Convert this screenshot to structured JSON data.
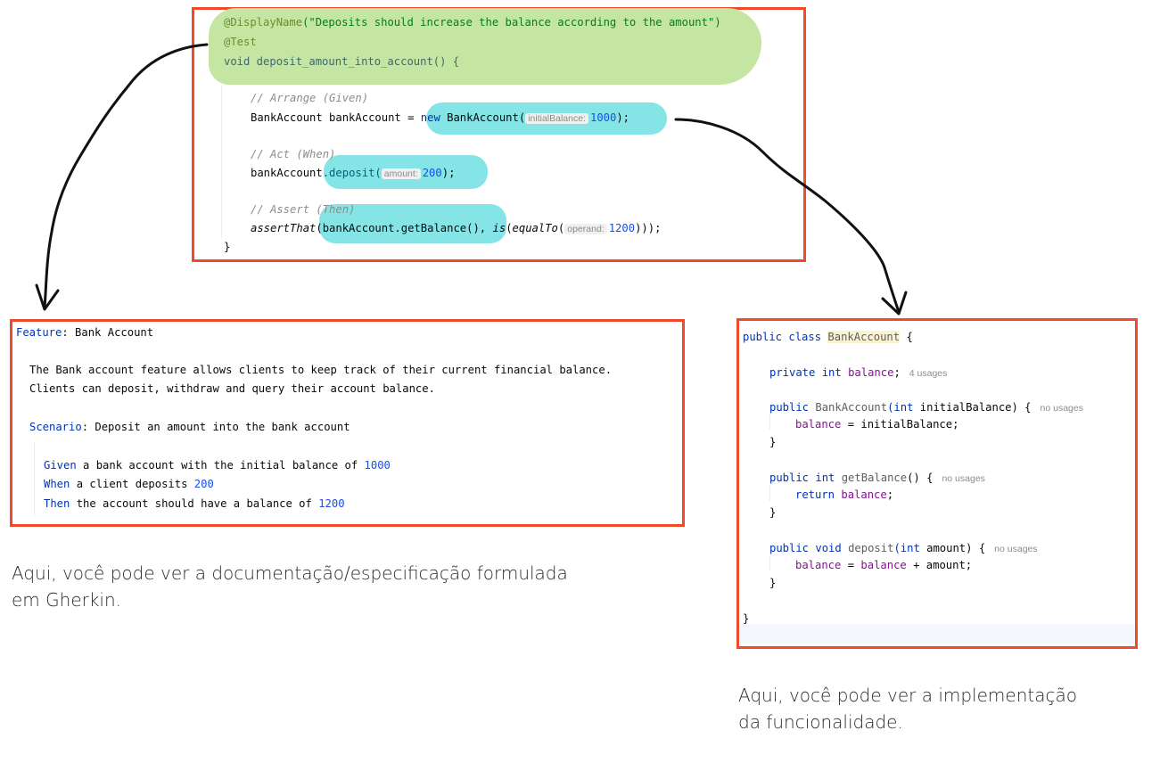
{
  "test_code": {
    "annotation_display_name": "@DisplayName",
    "display_name_string": "(\"Deposits should increase the balance according to the amount\")",
    "annotation_test": "@Test",
    "method_signature": "void deposit_amount_into_account() {",
    "comment_arrange": "// Arrange (Given)",
    "arrange_lhs": "BankAccount bankAccount = ",
    "arrange_new": "new",
    "arrange_ctor": " BankAccount(",
    "arrange_hint": "initialBalance:",
    "arrange_value": "1000",
    "arrange_end": ");",
    "comment_act": "// Act (When)",
    "act_obj": "bankAccount",
    "act_call": ".deposit(",
    "act_hint": "amount:",
    "act_value": "200",
    "act_end": ");",
    "comment_assert": "// Assert (Then)",
    "assert_fn": "assertThat",
    "assert_arg": "(bankAccount.getBalance(), ",
    "assert_is": "is",
    "assert_paren": "(",
    "assert_equal": "equalTo",
    "assert_paren2": "(",
    "assert_hint": "operand:",
    "assert_value": "1200",
    "assert_end": ")));",
    "closing_brace": "}"
  },
  "gherkin": {
    "feature_kw": "Feature",
    "feature_name": ": Bank Account",
    "description_line1": "The Bank account feature allows clients to keep track of their current financial balance.",
    "description_line2": "Clients can deposit, withdraw and query their account balance.",
    "scenario_kw": "Scenario",
    "scenario_name": ": Deposit an amount into the bank account",
    "steps": [
      {
        "keyword": "Given",
        "text": " a bank account with the initial balance of ",
        "value": "1000"
      },
      {
        "keyword": "When",
        "text": " a client deposits ",
        "value": "200"
      },
      {
        "keyword": "Then",
        "text": " the account should have a balance of ",
        "value": "1200"
      }
    ]
  },
  "impl_code": {
    "class_decl_kw": "public class ",
    "class_name": "BankAccount",
    "class_open": " {",
    "field_kw": "private int ",
    "field_name": "balance",
    "field_end": ";",
    "field_usages": "4 usages",
    "ctor_kw": "public ",
    "ctor_name": "BankAccount",
    "ctor_params_kw": "(int ",
    "ctor_params": "initialBalance) {",
    "ctor_usages": "no usages",
    "ctor_body_field": "balance",
    "ctor_body_rest": " = initialBalance;",
    "close1": "}",
    "get_kw": "public int ",
    "get_name": "getBalance",
    "get_rest": "() {",
    "get_usages": "no usages",
    "get_return_kw": "return ",
    "get_return_field": "balance",
    "get_return_end": ";",
    "close2": "}",
    "dep_kw": "public void ",
    "dep_name": "deposit",
    "dep_params_kw": "(int ",
    "dep_params": "amount) {",
    "dep_usages": "no usages",
    "dep_body_f1": "balance",
    "dep_body_eq": " = ",
    "dep_body_f2": "balance",
    "dep_body_rest": " + amount;",
    "close3": "}",
    "class_close": "}"
  },
  "captions": {
    "gherkin_line1": "Aqui, você pode ver a documentação/especificação formulada",
    "gherkin_line2": "em Gherkin.",
    "impl_line1": "Aqui, você pode ver a implementação",
    "impl_line2": "da funcionalidade."
  },
  "colors": {
    "frame": "#f04a2b",
    "highlight_green": "#c5e5a2",
    "highlight_cyan": "#85e4e6",
    "arrow": "#111111"
  }
}
